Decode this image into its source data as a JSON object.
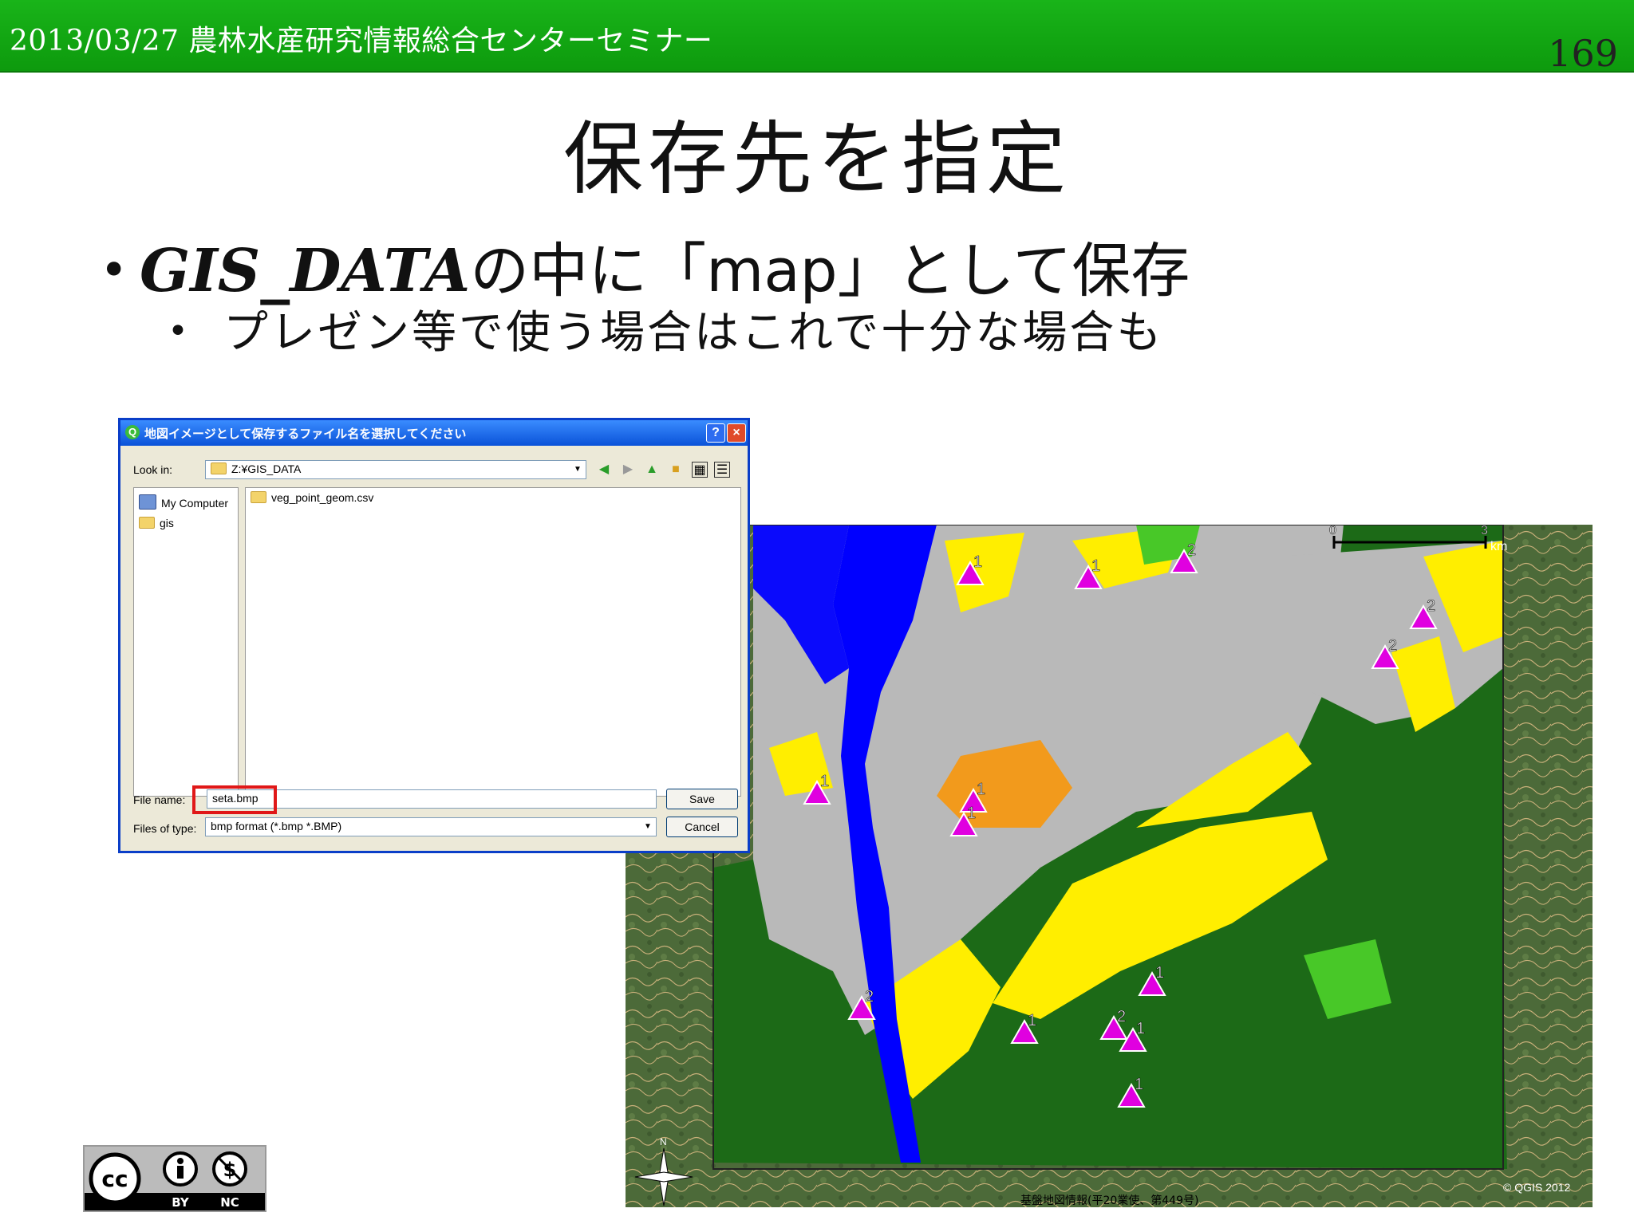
{
  "header": {
    "date_event": "2013/03/27 農林水産研究情報総合センターセミナー",
    "page_number": "169"
  },
  "slide": {
    "title": "保存先を指定",
    "bullet1": {
      "gothic": "GIS_DATA",
      "text": "の中に「map」として保存"
    },
    "bullet2": "プレゼン等で使う場合はこれで十分な場合も"
  },
  "dialog": {
    "title": "地図イメージとして保存するファイル名を選択してください",
    "help_label": "?",
    "close_label": "×",
    "look_in_label": "Look in:",
    "look_in_value": "Z:¥GIS_DATA",
    "places": [
      "My Computer",
      "gis"
    ],
    "files": [
      "veg_point_geom.csv"
    ],
    "file_name_label": "File name:",
    "file_name_value": "seta.bmp",
    "file_type_label": "Files of type:",
    "file_type_value": "bmp format (*.bmp *.BMP)",
    "save_label": "Save",
    "cancel_label": "Cancel"
  },
  "map": {
    "scale_start": "0",
    "scale_end": "3",
    "scale_unit": "km",
    "north_label": "N",
    "markers": [
      "1",
      "1",
      "2",
      "2",
      "2",
      "1",
      "1",
      "1",
      "2",
      "1",
      "1",
      "2",
      "1",
      "1"
    ],
    "credit": "基盤地図情報(平20業使、第449号)",
    "copyright": "© QGIS 2012",
    "colors": {
      "water": "#0000ff",
      "urban": "#bdbdbd",
      "farmland": "#ffee00",
      "forest": "#1d6e16",
      "grassland": "#48c828",
      "golf": "#f29a1c",
      "marker": "#e000e0"
    }
  },
  "license": {
    "by": "BY",
    "nc": "NC",
    "cc": "cc"
  }
}
